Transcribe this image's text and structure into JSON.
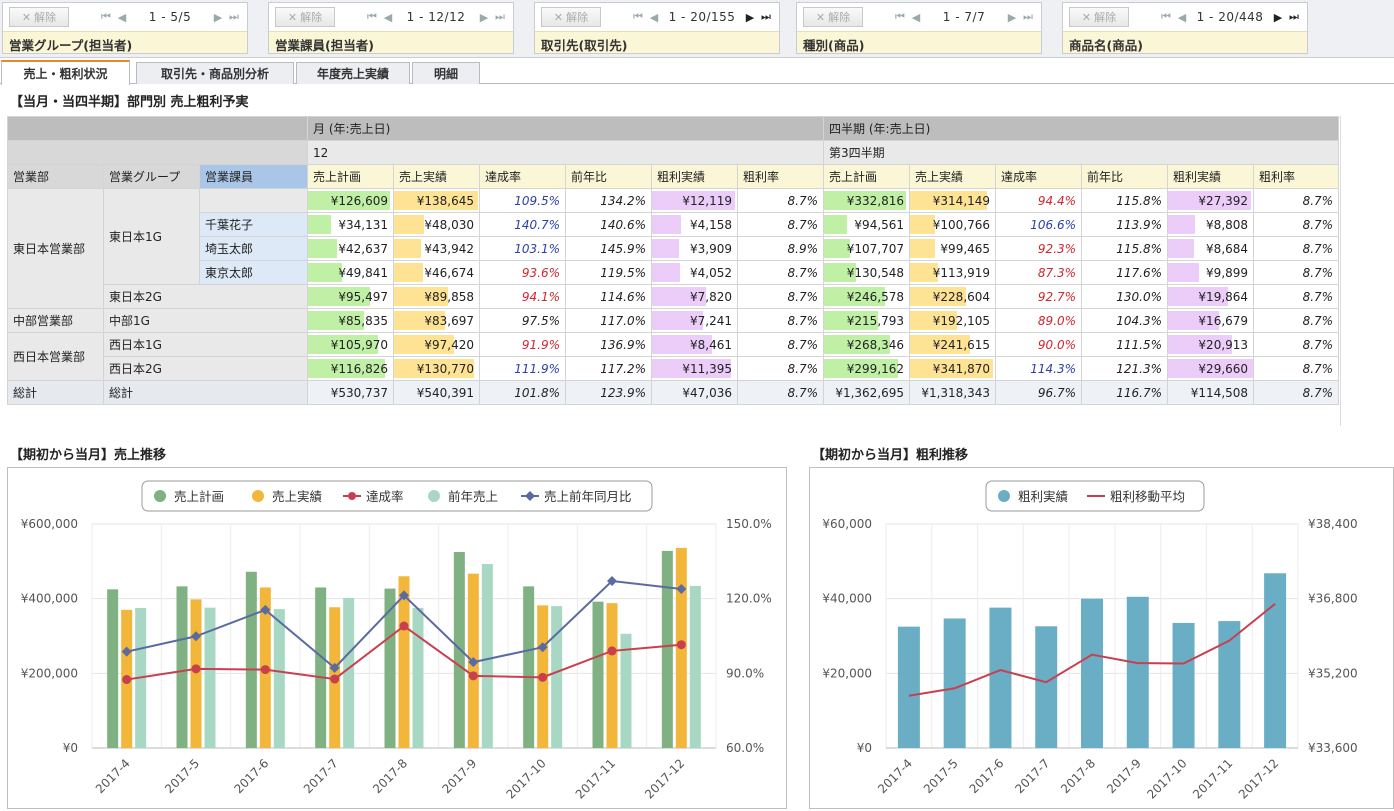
{
  "filters": [
    {
      "clear_label": "解除",
      "range": "1 - 5/5",
      "label": "営業グループ(担当者)",
      "has_next": false
    },
    {
      "clear_label": "解除",
      "range": "1 - 12/12",
      "label": "営業課員(担当者)",
      "has_next": false
    },
    {
      "clear_label": "解除",
      "range": "1 - 20/155",
      "label": "取引先(取引先)",
      "has_next": true
    },
    {
      "clear_label": "解除",
      "range": "1 - 7/7",
      "label": "種別(商品)",
      "has_next": false
    },
    {
      "clear_label": "解除",
      "range": "1 - 20/448",
      "label": "商品名(商品)",
      "has_next": true
    }
  ],
  "tabs": [
    "売上・粗利状況",
    "取引先・商品別分析",
    "年度売上実績",
    "明細"
  ],
  "active_tab": 0,
  "table_title": "【当月・当四半期】部門別 売上粗利予実",
  "table": {
    "group_month": "月 (年:売上日)",
    "group_quarter": "四半期 (年:売上日)",
    "month_value": "12",
    "quarter_value": "第3四半期",
    "dim_headers": [
      "営業部",
      "営業グループ",
      "営業課員"
    ],
    "measures": [
      "売上計画",
      "売上実績",
      "達成率",
      "前年比",
      "粗利実績",
      "粗利率"
    ],
    "rows": [
      {
        "dept": "東日本営業部",
        "group": "東日本1G",
        "person": "",
        "m": [
          "¥126,609",
          "¥138,645",
          "109.5%",
          "134.2%",
          "¥12,119",
          "8.7%"
        ],
        "q": [
          "¥332,816",
          "¥314,149",
          "94.4%",
          "115.8%",
          "¥27,392",
          "8.7%"
        ],
        "mbar": [
          0.97,
          0.99,
          0,
          0,
          0.98,
          0
        ],
        "qbar": [
          0.97,
          0.9,
          0,
          0,
          0.98,
          0
        ]
      },
      {
        "dept": "",
        "group": "",
        "person": "千葉花子",
        "m": [
          "¥34,131",
          "¥48,030",
          "140.7%",
          "140.6%",
          "¥4,158",
          "8.7%"
        ],
        "q": [
          "¥94,561",
          "¥100,766",
          "106.6%",
          "113.9%",
          "¥8,808",
          "8.7%"
        ],
        "mbar": [
          0.27,
          0.35,
          0,
          0,
          0.34,
          0
        ],
        "qbar": [
          0.27,
          0.29,
          0,
          0,
          0.32,
          0
        ]
      },
      {
        "dept": "",
        "group": "",
        "person": "埼玉太郎",
        "m": [
          "¥42,637",
          "¥43,942",
          "103.1%",
          "145.9%",
          "¥3,909",
          "8.9%"
        ],
        "q": [
          "¥107,707",
          "¥99,465",
          "92.3%",
          "115.8%",
          "¥8,684",
          "8.7%"
        ],
        "mbar": [
          0.34,
          0.32,
          0,
          0,
          0.32,
          0
        ],
        "qbar": [
          0.31,
          0.29,
          0,
          0,
          0.31,
          0
        ]
      },
      {
        "dept": "",
        "group": "",
        "person": "東京太郎",
        "m": [
          "¥49,841",
          "¥46,674",
          "93.6%",
          "119.5%",
          "¥4,052",
          "8.7%"
        ],
        "q": [
          "¥130,548",
          "¥113,919",
          "87.3%",
          "117.6%",
          "¥9,899",
          "8.7%"
        ],
        "mbar": [
          0.4,
          0.34,
          0,
          0,
          0.33,
          0
        ],
        "qbar": [
          0.38,
          0.33,
          0,
          0,
          0.36,
          0
        ]
      },
      {
        "dept": "",
        "group": "東日本2G",
        "person": "",
        "m": [
          "¥95,497",
          "¥89,858",
          "94.1%",
          "114.6%",
          "¥7,820",
          "8.7%"
        ],
        "q": [
          "¥246,578",
          "¥228,604",
          "92.7%",
          "130.0%",
          "¥19,864",
          "8.7%"
        ],
        "mbar": [
          0.73,
          0.64,
          0,
          0,
          0.64,
          0
        ],
        "qbar": [
          0.72,
          0.66,
          0,
          0,
          0.71,
          0
        ]
      },
      {
        "dept": "中部営業部",
        "group": "中部1G",
        "person": "",
        "m": [
          "¥85,835",
          "¥83,697",
          "97.5%",
          "117.0%",
          "¥7,241",
          "8.7%"
        ],
        "q": [
          "¥215,793",
          "¥192,105",
          "89.0%",
          "104.3%",
          "¥16,679",
          "8.7%"
        ],
        "mbar": [
          0.66,
          0.6,
          0,
          0,
          0.6,
          0
        ],
        "qbar": [
          0.63,
          0.55,
          0,
          0,
          0.6,
          0
        ]
      },
      {
        "dept": "西日本営業部",
        "group": "西日本1G",
        "person": "",
        "m": [
          "¥105,970",
          "¥97,420",
          "91.9%",
          "136.9%",
          "¥8,461",
          "8.7%"
        ],
        "q": [
          "¥268,346",
          "¥241,615",
          "90.0%",
          "111.5%",
          "¥20,913",
          "8.7%"
        ],
        "mbar": [
          0.82,
          0.7,
          0,
          0,
          0.7,
          0
        ],
        "qbar": [
          0.78,
          0.7,
          0,
          0,
          0.75,
          0
        ]
      },
      {
        "dept": "",
        "group": "西日本2G",
        "person": "",
        "m": [
          "¥116,826",
          "¥130,770",
          "111.9%",
          "117.2%",
          "¥11,395",
          "8.7%"
        ],
        "q": [
          "¥299,162",
          "¥341,870",
          "114.3%",
          "121.3%",
          "¥29,660",
          "8.7%"
        ],
        "mbar": [
          0.9,
          0.94,
          0,
          0,
          0.93,
          0
        ],
        "qbar": [
          0.87,
          0.98,
          0,
          0,
          1.0,
          0
        ]
      }
    ],
    "total": {
      "dept": "総計",
      "group": "総計",
      "m": [
        "¥530,737",
        "¥540,391",
        "101.8%",
        "123.9%",
        "¥47,036",
        "8.7%"
      ],
      "q": [
        "¥1,362,695",
        "¥1,318,343",
        "96.7%",
        "116.7%",
        "¥114,508",
        "8.7%"
      ]
    }
  },
  "chart1_title": "【期初から当月】売上推移",
  "chart2_title": "【期初から当月】粗利推移",
  "colors": {
    "plan": "#7fb183",
    "actual": "#f1b63a",
    "rate": "#c8404f",
    "prev": "#a8d8c4",
    "yoy": "#5a6aa3",
    "gross": "#6aaec5",
    "avg": "#c8404f",
    "plan_bar": "#bff0a6",
    "actual_bar": "#ffe394",
    "gross_bar": "#eccdfa"
  },
  "chart_data": [
    {
      "type": "bar",
      "categories": [
        "2017-4",
        "2017-5",
        "2017-6",
        "2017-7",
        "2017-8",
        "2017-9",
        "2017-10",
        "2017-11",
        "2017-12"
      ],
      "series": [
        {
          "name": "売上計画",
          "kind": "bar",
          "axis": "left",
          "values": [
            425000,
            433000,
            472000,
            430000,
            427000,
            525000,
            433000,
            392000,
            528000
          ]
        },
        {
          "name": "売上実績",
          "kind": "bar",
          "axis": "left",
          "values": [
            370000,
            398000,
            430000,
            377000,
            460000,
            467000,
            382000,
            388000,
            536000
          ]
        },
        {
          "name": "達成率",
          "kind": "line",
          "axis": "right",
          "values": [
            87.5,
            91.8,
            91.5,
            87.7,
            109.0,
            89.0,
            88.4,
            99.0,
            101.5
          ]
        },
        {
          "name": "前年売上",
          "kind": "bar",
          "axis": "left",
          "values": [
            375000,
            376000,
            372000,
            402000,
            375000,
            493000,
            380000,
            306000,
            434000
          ]
        },
        {
          "name": "売上前年同月比",
          "kind": "line",
          "axis": "right",
          "values": [
            98.7,
            104.9,
            115.5,
            92.2,
            121.3,
            94.5,
            100.5,
            127.1,
            123.9
          ]
        }
      ],
      "y_left": {
        "min": 0,
        "max": 600000,
        "ticks": [
          "¥0",
          "¥200,000",
          "¥400,000",
          "¥600,000"
        ]
      },
      "y_right": {
        "min": 60,
        "max": 150,
        "ticks": [
          "60.0%",
          "90.0%",
          "120.0%",
          "150.0%"
        ]
      },
      "legend_position": "top-center",
      "grid": true
    },
    {
      "type": "bar",
      "categories": [
        "2017-4",
        "2017-5",
        "2017-6",
        "2017-7",
        "2017-8",
        "2017-9",
        "2017-10",
        "2017-11",
        "2017-12"
      ],
      "series": [
        {
          "name": "粗利実績",
          "kind": "bar",
          "axis": "left",
          "values": [
            32500,
            34700,
            37600,
            32600,
            40000,
            40500,
            33500,
            34000,
            46800
          ]
        },
        {
          "name": "粗利移動平均",
          "kind": "line",
          "axis": "right",
          "values": [
            34720,
            34880,
            35270,
            35010,
            35600,
            35420,
            35410,
            35900,
            36690
          ]
        }
      ],
      "y_left": {
        "min": 0,
        "max": 60000,
        "ticks": [
          "¥0",
          "¥20,000",
          "¥40,000",
          "¥60,000"
        ]
      },
      "y_right": {
        "min": 33600,
        "max": 38400,
        "ticks": [
          "¥33,600",
          "¥35,200",
          "¥36,800",
          "¥38,400"
        ]
      },
      "legend_position": "top-center",
      "grid": true
    }
  ]
}
